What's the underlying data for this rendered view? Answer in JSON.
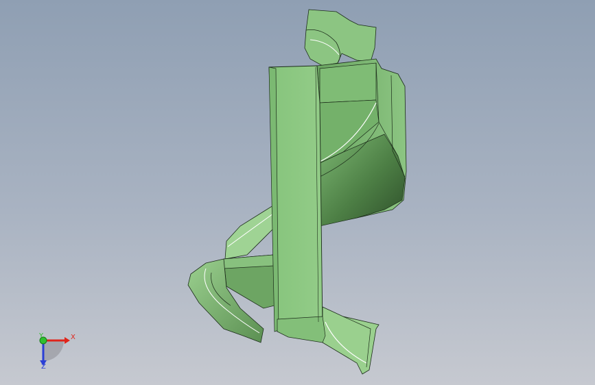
{
  "viewport": {
    "description_colors": {
      "background_top": "#8f9fb3",
      "background_bottom": "#c6c9d0",
      "model_fill": "#8ec784",
      "model_fill_dark": "#3f6a38",
      "model_fill_mid": "#6fa865",
      "edge": "#1a2a18"
    }
  },
  "triad": {
    "x_label": "X",
    "y_label": "Y",
    "z_label": "Z",
    "x_color": "#e0241b",
    "y_color": "#2fbf2f",
    "z_color": "#2a3fd6"
  }
}
